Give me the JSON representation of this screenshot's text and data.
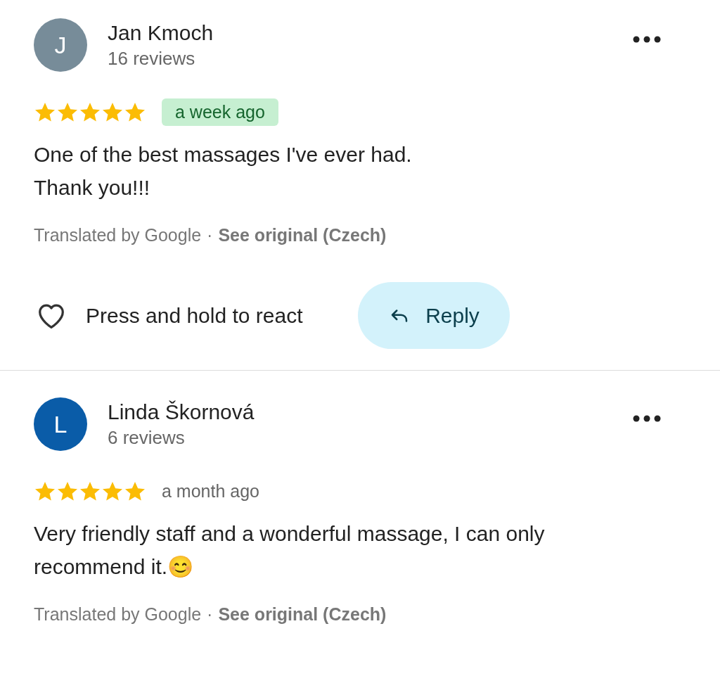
{
  "reviews": [
    {
      "avatar_letter": "J",
      "color": "#778c99",
      "name": "Jan Kmoch",
      "review_count": "16 reviews",
      "stars": 5,
      "date": "a week ago",
      "date_highlighted": true,
      "text_lines": [
        "One of the best massages I've ever had.",
        "Thank you!!!"
      ],
      "translated_by": "Translated by Google",
      "separator": "·",
      "see_original": "See original (Czech)",
      "actions": {
        "react_hint": "Press and hold to react",
        "reply_label": "Reply"
      }
    },
    {
      "avatar_letter": "L",
      "color": "#0a5ca8",
      "name": "Linda Škornová",
      "review_count": "6 reviews",
      "stars": 5,
      "date": "a month ago",
      "date_highlighted": false,
      "text_lines": [
        "Very friendly staff and a wonderful massage, I can only",
        "recommend it.😊"
      ],
      "translated_by": "Translated by Google",
      "separator": "·",
      "see_original": "See original (Czech)"
    }
  ]
}
